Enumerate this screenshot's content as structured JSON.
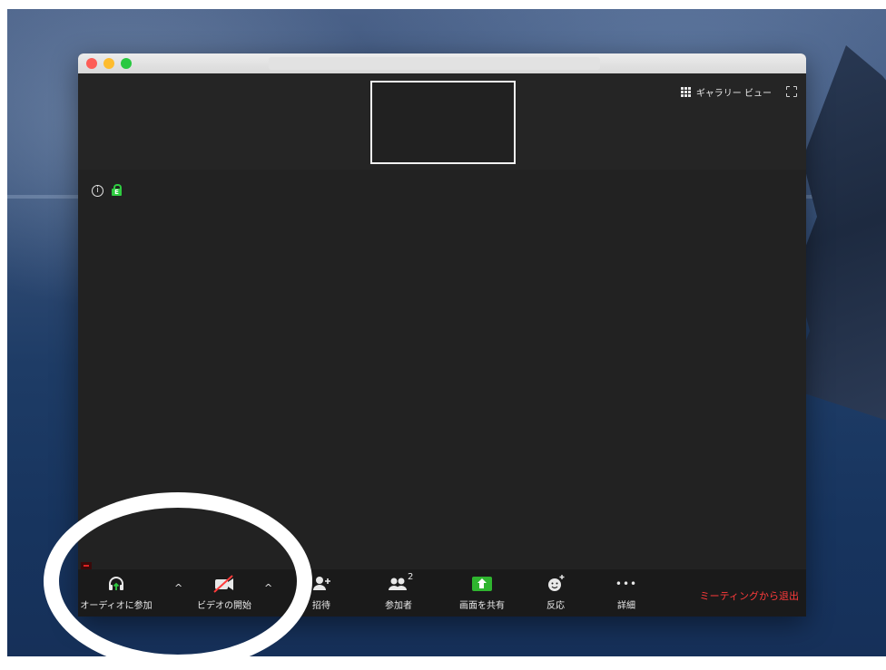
{
  "window": {
    "title": ""
  },
  "top_strip": {
    "gallery_view_label": "ギャラリー ビュー"
  },
  "toolbar": {
    "audio_label": "オーディオに参加",
    "video_label": "ビデオの開始",
    "invite_label": "招待",
    "participants_label": "参加者",
    "participants_count": "2",
    "share_label": "画面を共有",
    "reactions_label": "反応",
    "more_label": "詳細",
    "leave_label": "ミーティングから退出",
    "caret_glyph": "^",
    "more_glyph": "•••"
  },
  "info": {
    "info_glyph": "i",
    "lock_glyph": "E"
  },
  "colors": {
    "leave": "#ff3b3b",
    "share": "#2fb52f",
    "lock": "#2ecc40",
    "toolbar_bg": "#1a1a1a"
  }
}
